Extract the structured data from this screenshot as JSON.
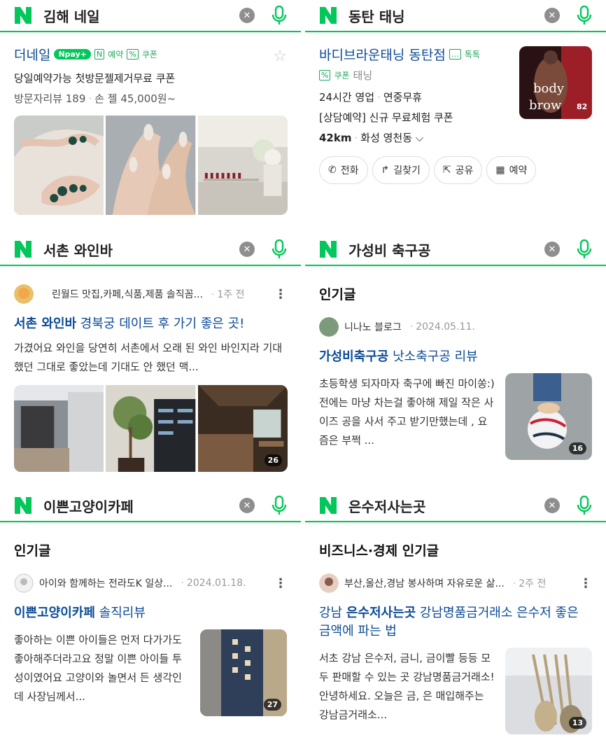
{
  "colors": {
    "naver_green": "#03c75a",
    "link_blue": "#0b4a96"
  },
  "panels": [
    {
      "query": "김해 네일",
      "place": {
        "name": "더네일",
        "npay": "pay+",
        "reserve": "예약",
        "coupon": "쿠폰",
        "desc": "당일예약가능 첫방문젤제거무료 쿠폰",
        "reviews": "방문자리뷰 189",
        "price": "손 젤 45,000원~"
      }
    },
    {
      "query": "동탄 태닝",
      "place": {
        "name": "바디브라운태닝 동탄점",
        "talk": "톡톡",
        "coupon": "쿠폰",
        "category": "태닝",
        "hours": "24시간 영업",
        "holiday": "연중무휴",
        "promo": "[상담예약] 신규 무료체험 쿠폰",
        "distance": "42km",
        "area": "화성 영천동",
        "thumb_text_1": "body",
        "thumb_text_2": "brow",
        "thumb_count": "82",
        "buttons": [
          "전화",
          "길찾기",
          "공유",
          "예약"
        ]
      }
    },
    {
      "query": "서촌 와인바",
      "blog": {
        "author": "린월드 맛집,카페,식품,제품 솔직꼼...",
        "time": "1주 전",
        "title_hl": "서촌 와인바",
        "title_rest": " 경북궁 데이트 후 가기 좋은 곳!",
        "desc": "가겼어요 와인을 당연히 서촌에서 오래 된 와인 바인지라 기대했던 그대로 좋았는데 기대도 안 했던 맥...",
        "img_count": "26"
      }
    },
    {
      "query": "가성비 축구공",
      "section": "인기글",
      "blog": {
        "author": "니나노 블로그",
        "time": "2024.05.11.",
        "title_hl": "가성비축구공",
        "title_rest": " 낫소축구공 리뷰",
        "desc": "초등학생 되자마자 축구에 빠진 마이쏭:) 전에는 마냥 차는걸 좋아해 제일 작은 사이즈 공을 사서 주고 받기만했는데 , 요즘은 부쩍 ...",
        "img_count": "16"
      }
    },
    {
      "query": "이쁜고양이카페",
      "section": "인기글",
      "blog": {
        "author": "아이와 함께하는 전라도K 일상...",
        "time": "2024.01.18.",
        "title_hl": "이쁜고양이카페",
        "title_rest": " 솔직리뷰",
        "desc": "좋아하는 이쁜 아이들은 먼저 다가가도 좋아해주더라고요 정말 이쁜 아이들 투성이였어요 고양이와 놀면서 든 생각인데 사장님께서...",
        "img_count": "27"
      }
    },
    {
      "query": "은수저사는곳",
      "section": "비즈니스·경제 인기글",
      "blog": {
        "author": "부산,울산,경남 봉사하며 자유로운 삶...",
        "time": "2주 전",
        "title_pre": "강남 ",
        "title_hl": "은수저사는곳",
        "title_rest": " 강남명품금거래소 은수저 좋은 금액에 파는 법",
        "desc": "서초 강남 은수저, 금니, 금이빨 등등 모두 판매할 수 있는 곳 강남명품금거래소! 안녕하세요. 오늘은 금, 은 매입해주는 강남금거래소...",
        "img_count": "13"
      }
    }
  ]
}
